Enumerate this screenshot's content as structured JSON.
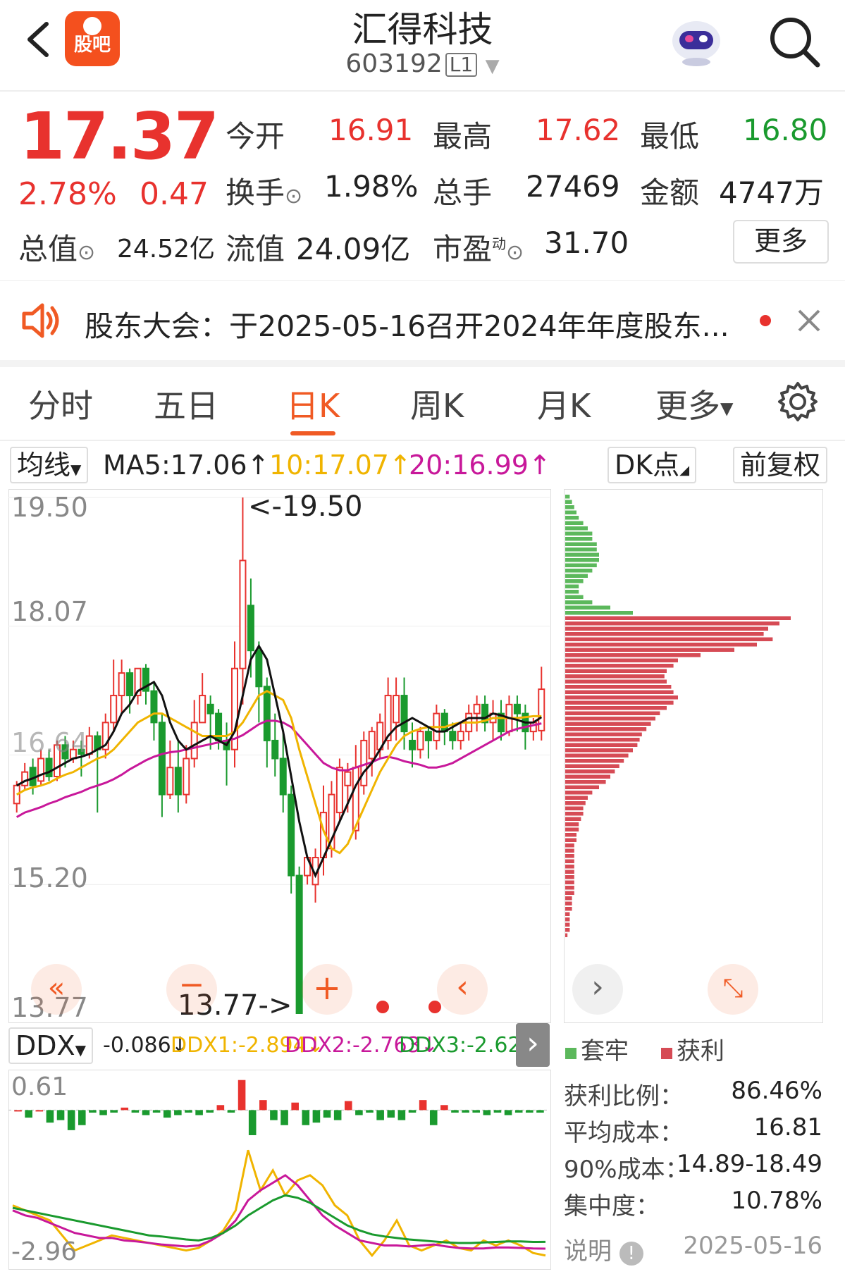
{
  "header": {
    "title": "汇得科技",
    "code": "603192",
    "code_badge": "L1",
    "logo_text": "股吧"
  },
  "quote": {
    "price": "17.37",
    "change_pct": "2.78%",
    "change": "0.47",
    "rows": [
      [
        {
          "label": "今开",
          "value": "16.91"
        },
        {
          "label": "最高",
          "value": "17.62"
        },
        {
          "label": "最低",
          "value": "16.80"
        }
      ],
      [
        {
          "label": "换手",
          "value": "1.98%"
        },
        {
          "label": "总手",
          "value": "27469"
        },
        {
          "label": "金额",
          "value": "4747万"
        }
      ]
    ],
    "total_value_label": "总值",
    "total_value": "24.52亿",
    "float_value_label": "流值",
    "float_value": "24.09亿",
    "pe_label": "市盈",
    "pe_sup": "动",
    "pe_value": "31.70",
    "more": "更多"
  },
  "notice": {
    "text": "股东大会：于2025-05-16召开2024年年度股东..."
  },
  "tabs": [
    "分时",
    "五日",
    "日K",
    "周K",
    "月K",
    "更多"
  ],
  "active_tab": "日K",
  "indicator": {
    "select": "均线",
    "ma5": "MA5:17.06↑",
    "ma10": "10:17.07↑",
    "ma20": "20:16.99↑",
    "dk": "DK点",
    "adjust": "前复权"
  },
  "price_axis": {
    "labels": [
      "19.50",
      "18.07",
      "16.64",
      "15.20",
      "13.77"
    ],
    "high_mark": "<-19.50",
    "low_mark": "13.77->"
  },
  "ddx": {
    "select": "DDX",
    "v0": "-0.086↓",
    "v1": "DDX1:-2.894↓",
    "v2": "DDX2:-2.763↓",
    "v3": "DDX3:-2.628↑",
    "top": "0.61",
    "bottom": "-2.96"
  },
  "chip": {
    "legend_trap": "套牢",
    "legend_profit": "获利",
    "rows": [
      {
        "label": "获利比例：",
        "value": "86.46%"
      },
      {
        "label": "平均成本：",
        "value": "16.81"
      },
      {
        "label": "90%成本：",
        "value": "14.89-18.49"
      },
      {
        "label": "集中度：",
        "value": "10.78%"
      }
    ],
    "note": "说明",
    "date": "2025-05-16"
  },
  "colors": {
    "red": "#e8322e",
    "green": "#1a9a2e",
    "accent": "#f05a24",
    "ma5": "#111111",
    "ma10": "#f0b400",
    "ma20": "#c8189a"
  },
  "chart_data": {
    "type": "candlestick",
    "ylim": [
      13.77,
      19.5
    ],
    "candles": [
      [
        16.1,
        16.3,
        16.0,
        16.35
      ],
      [
        16.3,
        16.45,
        16.25,
        16.55
      ],
      [
        16.5,
        16.3,
        16.2,
        16.6
      ],
      [
        16.35,
        16.6,
        16.3,
        16.7
      ],
      [
        16.6,
        16.4,
        16.35,
        16.7
      ],
      [
        16.4,
        16.75,
        16.35,
        16.8
      ],
      [
        16.75,
        16.6,
        16.5,
        16.85
      ],
      [
        16.6,
        16.7,
        16.55,
        16.8
      ],
      [
        16.7,
        16.65,
        16.4,
        16.8
      ],
      [
        16.65,
        16.85,
        16.6,
        16.95
      ],
      [
        16.85,
        16.7,
        16.0,
        16.9
      ],
      [
        16.7,
        17.0,
        16.6,
        17.1
      ],
      [
        17.0,
        17.3,
        16.9,
        17.7
      ],
      [
        17.3,
        17.55,
        17.1,
        17.7
      ],
      [
        17.55,
        17.3,
        17.1,
        17.6
      ],
      [
        17.3,
        17.6,
        17.2,
        17.6
      ],
      [
        17.6,
        17.35,
        17.2,
        17.65
      ],
      [
        17.35,
        17.0,
        16.8,
        17.45
      ],
      [
        17.0,
        16.2,
        15.95,
        17.1
      ],
      [
        16.2,
        16.5,
        16.15,
        16.8
      ],
      [
        16.5,
        16.2,
        16.0,
        16.8
      ],
      [
        16.2,
        16.6,
        16.1,
        16.75
      ],
      [
        16.6,
        17.0,
        16.5,
        17.25
      ],
      [
        17.0,
        17.3,
        17.0,
        17.55
      ],
      [
        17.2,
        17.1,
        16.7,
        17.3
      ],
      [
        17.1,
        16.8,
        16.7,
        17.15
      ],
      [
        16.8,
        16.7,
        16.3,
        17.0
      ],
      [
        16.7,
        17.6,
        16.5,
        17.9
      ],
      [
        17.6,
        18.8,
        17.2,
        19.5
      ],
      [
        18.3,
        17.8,
        17.5,
        18.6
      ],
      [
        17.8,
        17.4,
        17.0,
        17.9
      ],
      [
        17.4,
        16.8,
        16.5,
        17.5
      ],
      [
        16.8,
        16.6,
        16.4,
        17.1
      ],
      [
        16.6,
        16.2,
        16.0,
        16.9
      ],
      [
        16.2,
        15.3,
        15.1,
        16.3
      ],
      [
        15.3,
        13.77,
        13.77,
        15.4
      ],
      [
        15.3,
        15.5,
        15.2,
        15.5
      ],
      [
        15.2,
        15.5,
        15.0,
        15.6
      ],
      [
        15.5,
        16.0,
        15.3,
        16.3
      ],
      [
        15.6,
        16.2,
        15.5,
        16.35
      ],
      [
        16.0,
        16.5,
        15.9,
        16.6
      ],
      [
        16.3,
        16.45,
        16.0,
        16.55
      ],
      [
        15.8,
        16.5,
        15.7,
        16.75
      ],
      [
        16.3,
        16.8,
        16.2,
        16.9
      ],
      [
        16.6,
        16.9,
        16.4,
        16.95
      ],
      [
        16.7,
        17.0,
        16.6,
        17.1
      ],
      [
        16.8,
        17.3,
        16.7,
        17.5
      ],
      [
        17.0,
        17.3,
        16.8,
        17.5
      ],
      [
        17.3,
        16.9,
        16.7,
        17.5
      ],
      [
        16.8,
        16.7,
        16.5,
        17.0
      ],
      [
        16.7,
        16.9,
        16.6,
        16.95
      ],
      [
        16.9,
        16.8,
        16.6,
        16.95
      ],
      [
        16.8,
        17.1,
        16.7,
        17.2
      ],
      [
        17.1,
        16.9,
        16.75,
        17.15
      ],
      [
        16.9,
        16.8,
        16.7,
        17.0
      ],
      [
        16.8,
        16.9,
        16.7,
        17.0
      ],
      [
        16.9,
        17.1,
        16.8,
        17.2
      ],
      [
        17.1,
        17.2,
        16.9,
        17.3
      ],
      [
        17.2,
        17.0,
        16.9,
        17.3
      ],
      [
        17.0,
        17.1,
        16.8,
        17.25
      ],
      [
        17.1,
        16.9,
        16.8,
        17.25
      ],
      [
        16.9,
        17.2,
        16.85,
        17.3
      ],
      [
        17.2,
        17.1,
        16.9,
        17.3
      ],
      [
        17.1,
        16.9,
        16.7,
        17.2
      ],
      [
        16.9,
        17.0,
        16.8,
        17.05
      ],
      [
        16.91,
        17.37,
        16.8,
        17.62
      ]
    ],
    "ma5": [
      16.3,
      16.35,
      16.38,
      16.42,
      16.45,
      16.5,
      16.55,
      16.6,
      16.62,
      16.65,
      16.7,
      16.75,
      16.9,
      17.1,
      17.2,
      17.35,
      17.4,
      17.45,
      17.3,
      17.0,
      16.8,
      16.7,
      16.75,
      16.8,
      16.85,
      16.8,
      16.75,
      16.9,
      17.3,
      17.7,
      17.85,
      17.7,
      17.3,
      16.9,
      16.4,
      15.9,
      15.5,
      15.3,
      15.5,
      15.7,
      15.9,
      16.1,
      16.3,
      16.45,
      16.55,
      16.7,
      16.85,
      16.95,
      17.0,
      17.05,
      17.0,
      16.95,
      16.9,
      16.9,
      16.95,
      17.0,
      17.05,
      17.05,
      17.05,
      17.1,
      17.08,
      17.05,
      17.03,
      17.0,
      17.0,
      17.06
    ],
    "ma10": [
      16.2,
      16.25,
      16.28,
      16.3,
      16.33,
      16.38,
      16.42,
      16.45,
      16.5,
      16.55,
      16.6,
      16.63,
      16.7,
      16.8,
      16.9,
      17.0,
      17.05,
      17.1,
      17.1,
      17.05,
      17.0,
      16.95,
      16.9,
      16.85,
      16.85,
      16.85,
      16.85,
      16.9,
      17.0,
      17.15,
      17.3,
      17.35,
      17.3,
      17.25,
      17.05,
      16.7,
      16.4,
      16.1,
      15.8,
      15.6,
      15.55,
      15.65,
      15.85,
      16.05,
      16.25,
      16.45,
      16.6,
      16.75,
      16.85,
      16.9,
      16.93,
      16.95,
      16.95,
      16.95,
      16.98,
      17.0,
      17.0,
      17.0,
      17.02,
      17.05,
      17.05,
      17.05,
      17.05,
      17.06,
      17.07,
      17.07
    ],
    "ma20": [
      15.95,
      16.0,
      16.03,
      16.06,
      16.1,
      16.13,
      16.17,
      16.2,
      16.23,
      16.27,
      16.3,
      16.33,
      16.37,
      16.42,
      16.48,
      16.53,
      16.58,
      16.62,
      16.65,
      16.67,
      16.68,
      16.7,
      16.72,
      16.74,
      16.76,
      16.78,
      16.8,
      16.82,
      16.86,
      16.92,
      16.98,
      17.02,
      17.02,
      17.0,
      16.95,
      16.85,
      16.75,
      16.65,
      16.55,
      16.5,
      16.47,
      16.47,
      16.5,
      16.53,
      16.56,
      16.6,
      16.62,
      16.6,
      16.57,
      16.55,
      16.53,
      16.5,
      16.5,
      16.52,
      16.55,
      16.6,
      16.65,
      16.7,
      16.75,
      16.8,
      16.85,
      16.9,
      16.93,
      16.95,
      16.97,
      16.99
    ]
  },
  "ddx_chart": {
    "type": "bar+line",
    "ylim": [
      -2.96,
      0.61
    ],
    "ddx": [
      0,
      -0.15,
      0,
      -0.25,
      -0.2,
      -0.4,
      -0.3,
      -0.05,
      -0.1,
      -0.05,
      0.05,
      -0.05,
      -0.1,
      -0.05,
      -0.15,
      -0.1,
      -0.05,
      -0.1,
      -0.05,
      0.1,
      -0.05,
      0.6,
      -0.5,
      0.2,
      -0.2,
      -0.3,
      0.15,
      -0.3,
      -0.25,
      -0.15,
      -0.2,
      0.18,
      -0.1,
      -0.05,
      -0.2,
      -0.15,
      -0.2,
      -0.05,
      0.2,
      -0.3,
      0.1,
      -0.05,
      -0.05,
      -0.05,
      -0.1,
      -0.05,
      -0.1,
      -0.05,
      -0.05,
      -0.05
    ],
    "ddx1": [
      -1.9,
      -2.0,
      -2.1,
      -2.2,
      -2.5,
      -2.8,
      -2.7,
      -2.6,
      -2.5,
      -2.55,
      -2.6,
      -2.65,
      -2.7,
      -2.75,
      -2.8,
      -2.75,
      -2.6,
      -2.4,
      -2.0,
      -0.8,
      -1.6,
      -1.2,
      -1.7,
      -1.4,
      -1.3,
      -1.5,
      -1.9,
      -2.1,
      -2.6,
      -2.9,
      -2.6,
      -2.2,
      -2.7,
      -2.8,
      -2.7,
      -2.6,
      -2.75,
      -2.8,
      -2.6,
      -2.7,
      -2.6,
      -2.7,
      -2.85,
      -2.9
    ],
    "ddx2": [
      -2.0,
      -2.1,
      -2.15,
      -2.25,
      -2.35,
      -2.45,
      -2.5,
      -2.55,
      -2.55,
      -2.6,
      -2.62,
      -2.65,
      -2.68,
      -2.7,
      -2.72,
      -2.7,
      -2.6,
      -2.45,
      -2.2,
      -1.8,
      -1.6,
      -1.45,
      -1.3,
      -1.5,
      -1.8,
      -2.1,
      -2.3,
      -2.45,
      -2.6,
      -2.65,
      -2.7,
      -2.7,
      -2.72,
      -2.7,
      -2.68,
      -2.72,
      -2.75,
      -2.76,
      -2.76,
      -2.74,
      -2.74,
      -2.75,
      -2.76,
      -2.763
    ],
    "ddx3": [
      -1.95,
      -2.0,
      -2.05,
      -2.1,
      -2.15,
      -2.2,
      -2.25,
      -2.3,
      -2.35,
      -2.4,
      -2.45,
      -2.5,
      -2.52,
      -2.55,
      -2.58,
      -2.6,
      -2.55,
      -2.45,
      -2.3,
      -2.1,
      -1.95,
      -1.8,
      -1.7,
      -1.75,
      -1.85,
      -2.0,
      -2.15,
      -2.3,
      -2.4,
      -2.48,
      -2.52,
      -2.55,
      -2.58,
      -2.6,
      -2.62,
      -2.64,
      -2.65,
      -2.65,
      -2.64,
      -2.63,
      -2.62,
      -2.62,
      -2.63,
      -2.628
    ]
  },
  "chip_distribution": {
    "type": "horizontal-bar",
    "profit_color": "#d64b55",
    "trap_color": "#5cb85c",
    "trap": [
      0.02,
      0.03,
      0.04,
      0.05,
      0.06,
      0.08,
      0.1,
      0.12,
      0.12,
      0.14,
      0.14,
      0.15,
      0.15,
      0.14,
      0.12,
      0.1,
      0.08,
      0.06,
      0.06,
      0.08,
      0.12,
      0.2,
      0.3
    ],
    "profit": [
      1.0,
      0.95,
      0.9,
      0.88,
      0.92,
      0.85,
      0.75,
      0.6,
      0.5,
      0.48,
      0.45,
      0.44,
      0.45,
      0.47,
      0.48,
      0.5,
      0.48,
      0.45,
      0.42,
      0.4,
      0.38,
      0.36,
      0.34,
      0.33,
      0.32,
      0.3,
      0.28,
      0.26,
      0.24,
      0.22,
      0.2,
      0.18,
      0.15,
      0.12,
      0.1,
      0.09,
      0.08,
      0.08,
      0.07,
      0.06,
      0.06,
      0.05,
      0.05,
      0.04,
      0.04,
      0.04,
      0.04,
      0.04,
      0.04,
      0.04,
      0.04,
      0.04,
      0.04,
      0.03,
      0.03,
      0.03,
      0.02,
      0.02,
      0.02,
      0.02,
      0.01
    ]
  }
}
